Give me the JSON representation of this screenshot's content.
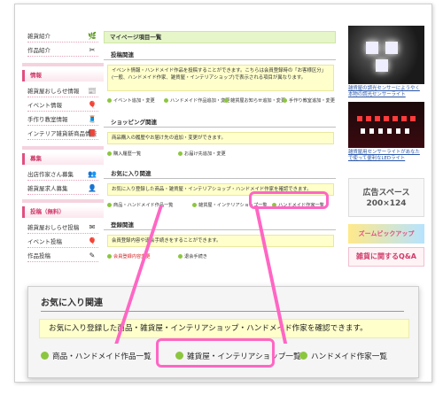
{
  "sidebar": {
    "items_top": [
      {
        "label": "雑貨紹介",
        "icon": "🌿"
      },
      {
        "label": "作品紹介",
        "icon": "✂"
      }
    ],
    "info_head": "情報",
    "info_items": [
      {
        "label": "雑貨屋おしらせ情報",
        "icon": "📰"
      },
      {
        "label": "イベント情報",
        "icon": "🎈"
      },
      {
        "label": "手作り教室情報",
        "icon": "🧵"
      },
      {
        "label": "インテリア雑貨新商品情報",
        "icon": "📕"
      }
    ],
    "recruit_head": "募集",
    "recruit_items": [
      {
        "label": "出店作家さん募集",
        "icon": "👥"
      },
      {
        "label": "雑貨屋求人募集",
        "icon": "👤"
      }
    ],
    "post_head": "投稿（無料）",
    "post_items": [
      {
        "label": "雑貨屋おしらせ投稿",
        "icon": "✉"
      },
      {
        "label": "イベント投稿",
        "icon": "🎈"
      },
      {
        "label": "作品投稿",
        "icon": "✎"
      }
    ]
  },
  "main": {
    "page_title": "マイページ項目一覧",
    "sections": [
      {
        "title": "投稿関連",
        "note": "イベント情報・ハンドメイド作品を投稿することができます。こちらは会員登録時の「お客様区分」(一般、ハンドメイド作家、雑貨屋・インテリアショップ)で表示される項目が異なります。",
        "links": [
          "イベント追加・変更",
          "ハンドメイド作品追加・変更",
          "雑貨屋お知らせ追加・変更",
          "手作り教室追加・変更"
        ]
      },
      {
        "title": "ショッピング関連",
        "note": "商品購入の履歴やお届け先の追加・変更ができます。",
        "links": [
          "購入履歴一覧",
          "お届け先追加・変更"
        ]
      },
      {
        "title": "お気に入り関連",
        "note": "お気に入り登録した商品・雑貨屋・インテリアショップ・ハンドメイド作家を確認できます。",
        "links": [
          "商品・ハンドメイド作品一覧",
          "雑貨屋・インテリアショップ一覧",
          "ハンドメイド作家一覧"
        ]
      },
      {
        "title": "登録関連",
        "note": "会員登録内容や退会手続きをすることができます。",
        "links": [
          "会員登録内容変更",
          "退会手続き"
        ]
      }
    ]
  },
  "right_column": {
    "ad1_caption": "雑貨屋の調光センサーにようやく本物の調光センサーライト",
    "ad2_caption": "雑貨屋用センサーライトがあなたで使って便利なLEDライト",
    "ad_space_title": "広告スペース",
    "ad_space_size": "200×124",
    "ad3_text": "ズームピックアップ",
    "ad4_text": "雑貨に関するQ&A"
  },
  "zoom_panel": {
    "title": "お気に入り関連",
    "note": "お気に入り登録した商品・雑貨屋・インテリアショップ・ハンドメイド作家を確認できます。",
    "links": [
      "商品・ハンドメイド作品一覧",
      "雑貨屋・インテリアショップ一覧",
      "ハンドメイド作家一覧"
    ]
  },
  "colors": {
    "highlight": "#ff66c4",
    "link_bullet": "#8cc63f",
    "note_bg": "#ffffcc",
    "sidebar_accent": "#e05080",
    "title_bg": "#e6f6c9"
  }
}
